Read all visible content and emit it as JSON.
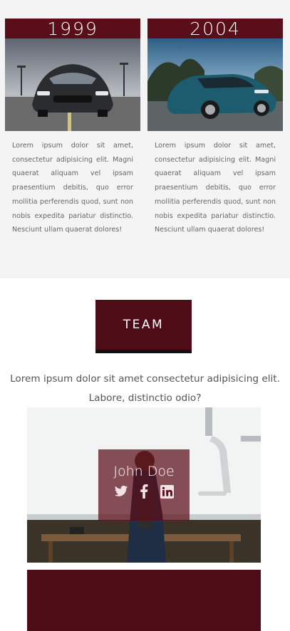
{
  "history": {
    "cards": [
      {
        "year": "1999",
        "text": "Lorem ipsum dolor sit amet, consectetur adipisicing elit. Magni quaerat aliquam vel ipsam praesentium debitis, quo error mollitia perferendis quod, sunt non nobis expedita pariatur distinctio. Nesciunt ullam quaerat dolores!"
      },
      {
        "year": "2004",
        "text": "Lorem ipsum dolor sit amet, consectetur adipisicing elit. Magni quaerat aliquam vel ipsam praesentium debitis, quo error mollitia perferendis quod, sunt non nobis expedita pariatur distinctio. Nesciunt ullam quaerat dolores!"
      }
    ]
  },
  "team": {
    "button_label": "TEAM",
    "intro": "Lorem ipsum dolor sit amet consectetur adipisicing elit. Labore, distinctio odio?",
    "members": [
      {
        "name": "John Doe",
        "socials": [
          "twitter-icon",
          "facebook-icon",
          "linkedin-icon"
        ]
      }
    ]
  },
  "colors": {
    "accent": "#5a0e19",
    "section_bg": "#f4f4f4"
  }
}
